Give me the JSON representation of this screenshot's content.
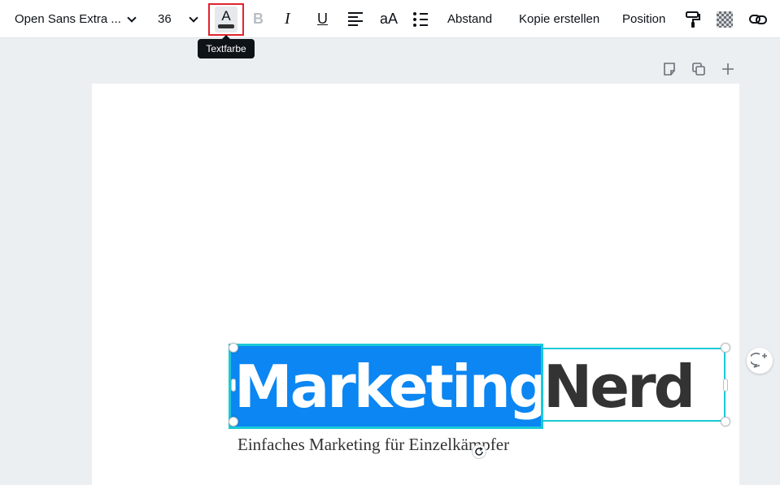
{
  "toolbar": {
    "font_name": "Open Sans Extra ...",
    "font_size": "36",
    "text_color_letter": "A",
    "text_color_value": "#2f2f2f",
    "bold_label": "B",
    "italic_label": "I",
    "underline_label": "U",
    "case_label": "aA",
    "spacing_label": "Abstand",
    "copy_label": "Kopie erstellen",
    "position_label": "Position",
    "icons": [
      "chevron-down-icon",
      "text-color-icon",
      "bold-icon",
      "italic-icon",
      "underline-icon",
      "align-left-icon",
      "letter-case-icon",
      "list-icon",
      "paint-roller-icon",
      "transparency-icon",
      "link-icon"
    ]
  },
  "tooltip": {
    "text": "Textfarbe"
  },
  "page_actions": [
    "note-icon",
    "duplicate-page-icon",
    "add-page-icon"
  ],
  "canvas": {
    "headline_selected": "Marketing",
    "headline_rest": "Nerd",
    "subtitle": "Einfaches Marketing für Einzelkämpfer",
    "selection_color": "#0b86f2",
    "frame_color": "#19c9d8",
    "headline_text_color": "#333333"
  },
  "colors": {
    "highlight_border": "#e0242f",
    "background": "#eceff2"
  }
}
